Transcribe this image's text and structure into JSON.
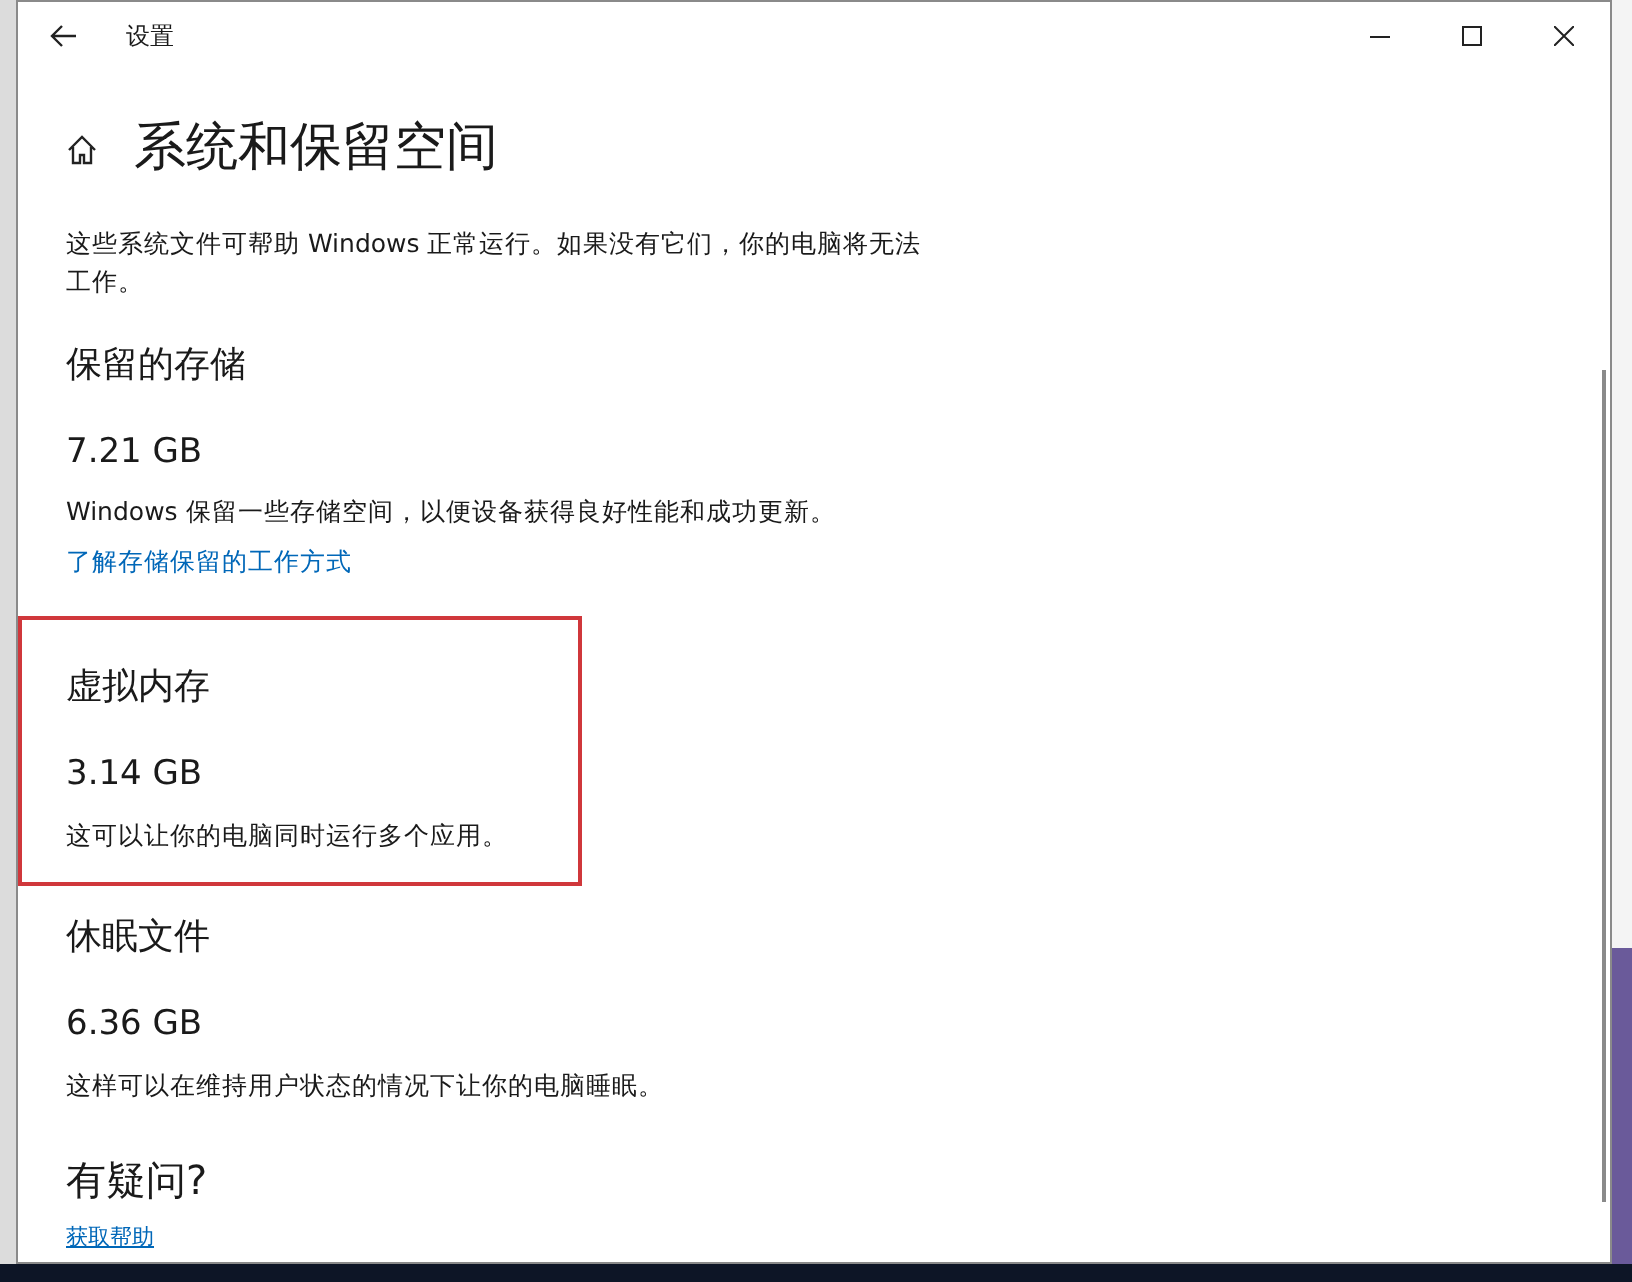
{
  "window": {
    "title": "设置"
  },
  "page": {
    "title": "系统和保留空间",
    "description": "这些系统文件可帮助 Windows 正常运行。如果没有它们，你的电脑将无法工作。"
  },
  "sections": [
    {
      "heading": "保留的存储",
      "size": "7.21 GB",
      "description": "Windows 保留一些存储空间，以便设备获得良好性能和成功更新。",
      "link": "了解存储保留的工作方式",
      "highlighted": false
    },
    {
      "heading": "虚拟内存",
      "size": "3.14 GB",
      "description": "这可以让你的电脑同时运行多个应用。",
      "highlighted": true
    },
    {
      "heading": "休眠文件",
      "size": "6.36 GB",
      "description": "这样可以在维持用户状态的情况下让你的电脑睡眠。",
      "highlighted": false
    }
  ],
  "help": {
    "heading": "有疑问?",
    "link": "获取帮助"
  }
}
